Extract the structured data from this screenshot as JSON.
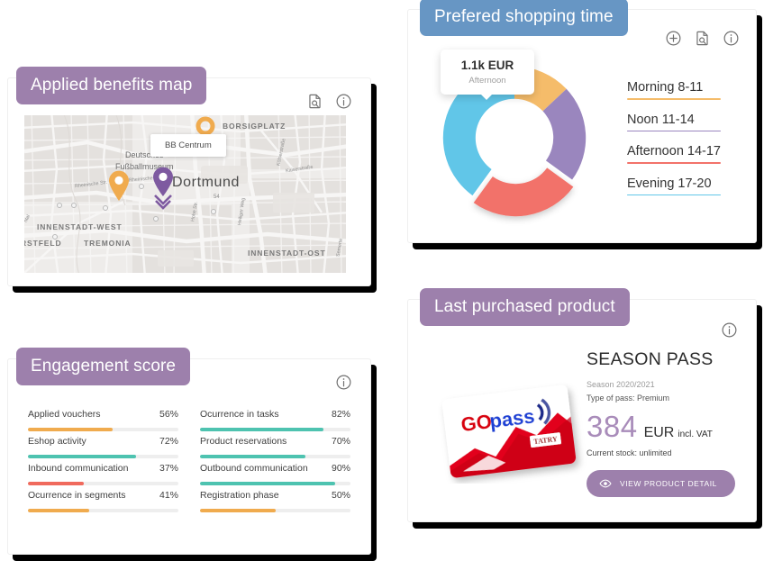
{
  "cards": {
    "map": {
      "title": "Applied benefits map",
      "pill_color": "#9d80ac",
      "icons": [
        "document-search-icon",
        "info-icon"
      ],
      "tooltip": "BB Centrum",
      "city_label": "Dortmund",
      "district_labels": [
        "BORSIGPLATZ",
        "INNENSTADT-WEST",
        "TREMONIA",
        "INNENSTADT-OST",
        "RSTFELD"
      ],
      "poi_label": "Deutsches\nFußballmuseum",
      "poi_line1": "Deutsches",
      "poi_line2": "Fußballmuseum",
      "street_labels": [
        "Rheinische Str.",
        "Rheinische Str.",
        "Hohe Str.",
        "Kaiserstraße",
        "Heiliger Weg",
        "Kölnerstraße",
        "Semerte",
        "ntal",
        "54"
      ],
      "pins": [
        {
          "name": "pin-orange-top",
          "color": "#f0ab4e",
          "type": "ring"
        },
        {
          "name": "pin-orange-left",
          "color": "#f0ab4e",
          "type": "marker"
        },
        {
          "name": "pin-purple-selected",
          "color": "#7e5aa0",
          "type": "marker-selected"
        }
      ]
    },
    "engagement": {
      "title": "Engagement score",
      "pill_color": "#9d80ac",
      "icons": [
        "info-icon"
      ],
      "metrics_left": [
        {
          "label": "Applied vouchers",
          "value": "56%",
          "pct": 56,
          "color": "#f0ab4e"
        },
        {
          "label": "Eshop activity",
          "value": "72%",
          "pct": 72,
          "color": "#4ec3b0"
        },
        {
          "label": "Inbound communication",
          "value": "37%",
          "pct": 37,
          "color": "#f06a5d"
        },
        {
          "label": "Ocurrence in segments",
          "value": "41%",
          "pct": 41,
          "color": "#f0ab4e"
        }
      ],
      "metrics_right": [
        {
          "label": "Ocurrence in tasks",
          "value": "82%",
          "pct": 82,
          "color": "#4ec3b0"
        },
        {
          "label": "Product reservations",
          "value": "70%",
          "pct": 70,
          "color": "#4ec3b0"
        },
        {
          "label": "Outbound communication",
          "value": "90%",
          "pct": 90,
          "color": "#4ec3b0"
        },
        {
          "label": "Registration phase",
          "value": "50%",
          "pct": 50,
          "color": "#f0ab4e"
        }
      ]
    },
    "shopping": {
      "title": "Prefered shopping time",
      "pill_color": "#6796c4",
      "icons": [
        "add-circle-icon",
        "document-search-icon",
        "info-icon"
      ],
      "tooltip_value": "1.1k EUR",
      "tooltip_label": "Afternoon",
      "legend": [
        {
          "label": "Morning 8-11",
          "color": "#f5bc6a"
        },
        {
          "label": "Noon 11-14",
          "color": "#9a86be"
        },
        {
          "label": "Afternoon 14-17",
          "color": "#f2726a"
        },
        {
          "label": "Evening 17-20",
          "color": "#61c6e8"
        }
      ]
    },
    "product": {
      "title": "Last purchased product",
      "pill_color": "#9d80ac",
      "icons": [
        "info-icon"
      ],
      "product_name": "SEASON PASS",
      "season": "Season 2020/2021",
      "pass_type": "Type of pass: Premium",
      "price": "384",
      "currency": "EUR",
      "vat_note": "incl. VAT",
      "stock": "Current stock: unlimited",
      "button_label": "VIEW PRODUCT DETAIL",
      "button_icon": "eye-icon",
      "card_art": {
        "brand_go": "GO",
        "brand_pass": "pass",
        "logo_text": "TATRY"
      }
    }
  },
  "chart_data": {
    "type": "pie",
    "title": "Prefered shopping time",
    "categories": [
      "Morning 8-11",
      "Noon 11-14",
      "Afternoon 14-17",
      "Evening 17-20"
    ],
    "values": [
      13,
      22,
      25,
      40
    ],
    "colors": [
      "#f5bc6a",
      "#9a86be",
      "#f2726a",
      "#61c6e8"
    ],
    "highlighted": "Afternoon 14-17",
    "highlight_value": "1.1k EUR",
    "legend_position": "right",
    "donut": true
  }
}
